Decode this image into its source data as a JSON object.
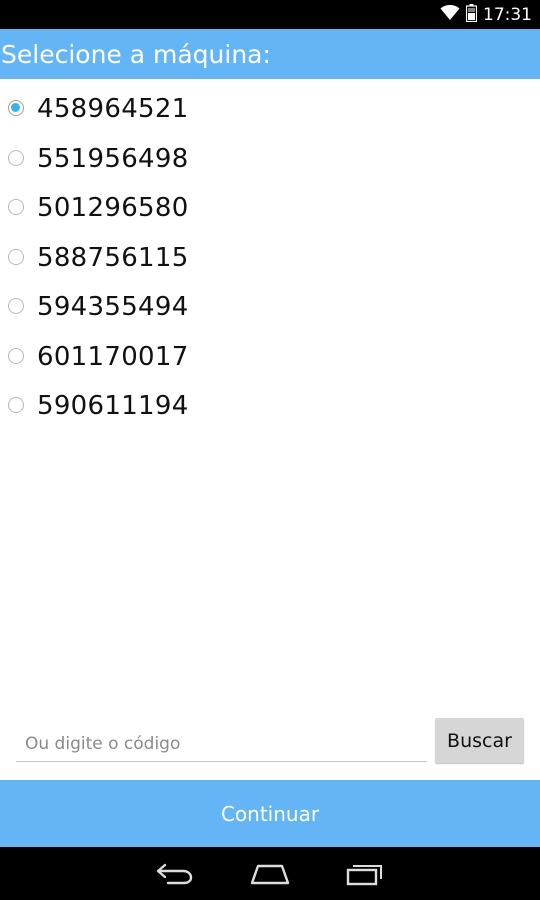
{
  "status_bar": {
    "time": "17:31",
    "icons": [
      "wifi-icon",
      "battery-icon"
    ]
  },
  "header": {
    "title": "Selecione a máquina:"
  },
  "machines": {
    "selected_index": 0,
    "options": [
      {
        "label": "458964521",
        "checked": true
      },
      {
        "label": "551956498",
        "checked": false
      },
      {
        "label": "501296580",
        "checked": false
      },
      {
        "label": "588756115",
        "checked": false
      },
      {
        "label": "594355494",
        "checked": false
      },
      {
        "label": "601170017",
        "checked": false
      },
      {
        "label": "590611194",
        "checked": false
      }
    ]
  },
  "search": {
    "placeholder": "Ou digite o código",
    "value": "",
    "button_label": "Buscar"
  },
  "footer": {
    "continue_label": "Continuar"
  },
  "navigation": {
    "icons": [
      "back-icon",
      "home-icon",
      "recent-apps-icon"
    ]
  },
  "colors": {
    "accent": "#64b5f6",
    "radio_selected": "#33b5e5",
    "status_bar": "#000000",
    "button_gray": "#d6d6d6"
  }
}
